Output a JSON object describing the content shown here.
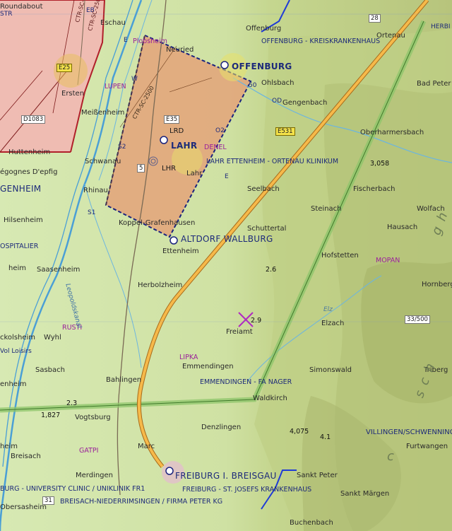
{
  "map": {
    "labels": {
      "rb": "Roundabout",
      "str": "STR",
      "eb": "EB",
      "eschau": "Eschau",
      "plobsheim": "Plobsheim",
      "e_small": "E",
      "neuried": "Neuried",
      "offenburg_kh": "OFFENBURG - KREISKRANKENHAUS",
      "offenburg": "OFFENBURG",
      "offenburg_small": "Offenburg",
      "ohlsbach": "Ohlsbach",
      "od": "OD",
      "gengenbach": "Gengenbach",
      "ortenau": "Ortenau",
      "herbi": "HERBI",
      "bad_peter": "Bad Peter",
      "lupen": "LUPEN",
      "w": "W",
      "e25": "E25",
      "ersten": "Ersten",
      "meissenheim": "Meißenheim",
      "d1083": "D1083",
      "huttenheim": "Huttenheim",
      "schwanau": "Schwanau",
      "s2": "S2",
      "e35": "E35",
      "lrd": "LRD",
      "lahr": "LAHR",
      "denel": "DENEL",
      "o2": "O2",
      "e531": "E531",
      "oberharmersbach": "Oberharmersbach",
      "lhr": "LHR",
      "lahr_small": "Lahr",
      "lahr_ettenheim": "LAHR ETTENHEIM - ORTENAU KLINIKUM",
      "e_lahr": "E",
      "seelbach": "Seelbach",
      "elev_3058": "3,058",
      "fischerbach": "Fischerbach",
      "egognes": "égognes D'epfig",
      "genheim": "GENHEIM",
      "rhinau": "Rhinau",
      "steinach": "Steinach",
      "wolfach": "Wolfach",
      "s1": "S1",
      "hilsenheim": "Hilsenheim",
      "koppel": "Koppel-Grafenhausen",
      "schuttertal": "Schuttertal",
      "hausach": "Hausach",
      "ospitalier": "OSPITALIER",
      "altdorf": "ALTDORF WALLBURG",
      "ettenheim": "Ettenheim",
      "hofstetten": "Hofstetten",
      "mopan": "MOPAN",
      "heim": "heim",
      "saasenheim": "Saasenheim",
      "elev_2_6": "2.6",
      "hornberg": "Hornberg",
      "herbolzheim": "Herbolzheim",
      "elz": "Elz",
      "elzach": "Elzach",
      "elev_2_9": "2.9",
      "rusti": "RUSTI",
      "freiamt": "Freiamt",
      "freq": "33/500",
      "ckolsheim": "ckolsheim",
      "wyhl": "Wyhl",
      "vol_loisirs": "Vol Loisirs",
      "lipka": "LIPKA",
      "triberg": "Triberg",
      "emmendingen": "Emmendingen",
      "sasbach": "Sasbach",
      "simonswald": "Simonswald",
      "enheim": "enheim",
      "bahlingen": "Bahlingen",
      "emmendingen_fa": "EMMENDINGEN - FA NAGER",
      "waldkirch": "Waldkirch",
      "elev_2_3": "2.3",
      "elev_1827": "1,827",
      "vogtsburg": "Vogtsburg",
      "denzlingen": "Denzlingen",
      "elev_4075": "4,075",
      "elev_4_1": "4.1",
      "villingen": "VILLINGEN/SCHWENNING",
      "furtwangen": "Furtwangen",
      "heim2": "heim",
      "gatpi": "GATPI",
      "marc": "Marc",
      "breisach": "Breisach",
      "merdingen": "Merdingen",
      "sankt_peter": "Sankt Peter",
      "freiburg": "FREIBURG I. BREISGAU",
      "freiburg_uni": "BURG - UNIVERSITY CLINIC / UNIKLINIK FR1",
      "freiburg_st": "FREIBURG - ST. JOSEFS KRANKENHAUS",
      "sankt_margen": "Sankt Märgen",
      "obersasheim": "Obersasheim",
      "r31": "31",
      "breisach_nied": "BREISACH-NIEDERRIMSINGEN / FIRMA PETER KG",
      "buchenbach": "Buchenbach",
      "ctr": "CTR-SC-2500",
      "ctr2": "CTR-SC-2500",
      "ctr3": "CTR-SC-2500",
      "r28": "28",
      "r5": "5",
      "r50": "50",
      "leopoldskanal": "Leopoldskanal",
      "gh": "g h",
      "sgh": "s c h",
      "c": "c"
    },
    "colors": {
      "terrain_low": "#cfe3a8",
      "terrain_high": "#b9c982",
      "ctr_fill": "#e6a77a",
      "ctr_border": "#1a237e",
      "red_zone": "#f0b3b0",
      "route": "#f6b94a",
      "green_corridor": "#8cc46a",
      "river": "#4a9fd6"
    }
  }
}
